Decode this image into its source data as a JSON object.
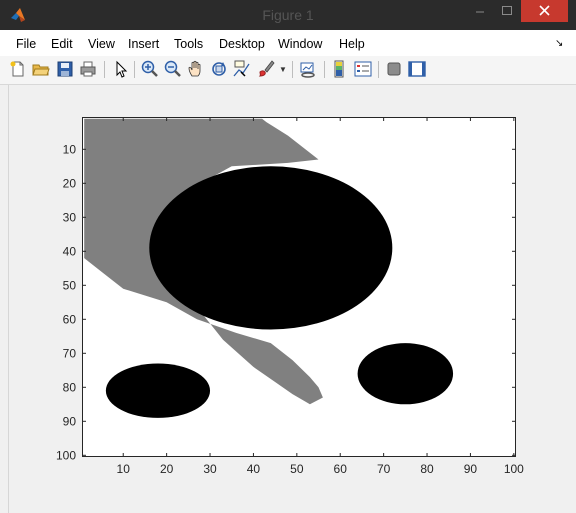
{
  "window": {
    "title": "Figure 1"
  },
  "menu": [
    "File",
    "Edit",
    "View",
    "Insert",
    "Tools",
    "Desktop",
    "Window",
    "Help"
  ],
  "toolbar": {
    "buttons": [
      "new-figure",
      "open-file",
      "save",
      "print",
      "edit-plot-pointer",
      "zoom-in",
      "zoom-out",
      "pan",
      "rotate-3d",
      "data-cursor",
      "brush",
      "link-plot",
      "insert-colorbar",
      "insert-legend",
      "hide-plot-tools",
      "show-plot-tools"
    ]
  },
  "colors": {
    "gray_region": "#808080",
    "ellipse": "#000000",
    "background": "#ffffff"
  },
  "chart_data": {
    "type": "heatmap",
    "colormap": "gray",
    "x_ticks": [
      "10",
      "20",
      "30",
      "40",
      "50",
      "60",
      "70",
      "80",
      "90",
      "100"
    ],
    "y_ticks": [
      "10",
      "20",
      "30",
      "40",
      "50",
      "60",
      "70",
      "80",
      "90",
      "100"
    ],
    "xlim": [
      0.5,
      100.5
    ],
    "ylim": [
      0.5,
      100.5
    ],
    "y_direction": "reverse",
    "ellipses": [
      {
        "cx": 44,
        "cy": 39,
        "rx": 28,
        "ry": 24,
        "value": 0
      },
      {
        "cx": 18,
        "cy": 81,
        "rx": 12,
        "ry": 8,
        "value": 0
      },
      {
        "cx": 75,
        "cy": 76,
        "rx": 11,
        "ry": 9,
        "value": 0
      }
    ],
    "gray_region": {
      "value": 0.5,
      "boundary_left": [
        [
          1,
          1
        ],
        [
          1,
          42
        ],
        [
          5,
          46
        ],
        [
          10,
          51
        ],
        [
          20,
          55
        ],
        [
          27,
          60
        ],
        [
          36,
          64
        ],
        [
          44,
          67
        ],
        [
          49,
          72
        ],
        [
          53,
          77
        ],
        [
          55,
          80
        ],
        [
          56,
          83
        ],
        [
          53,
          85
        ]
      ],
      "boundary_right": [
        [
          53,
          85
        ],
        [
          49,
          82
        ],
        [
          40,
          74
        ],
        [
          33,
          66
        ],
        [
          28,
          58
        ],
        [
          20,
          47
        ],
        [
          18,
          32
        ],
        [
          25,
          22
        ],
        [
          35,
          15
        ],
        [
          48,
          14
        ],
        [
          55,
          13
        ],
        [
          48,
          6
        ],
        [
          43,
          2
        ],
        [
          42,
          1
        ]
      ]
    }
  }
}
